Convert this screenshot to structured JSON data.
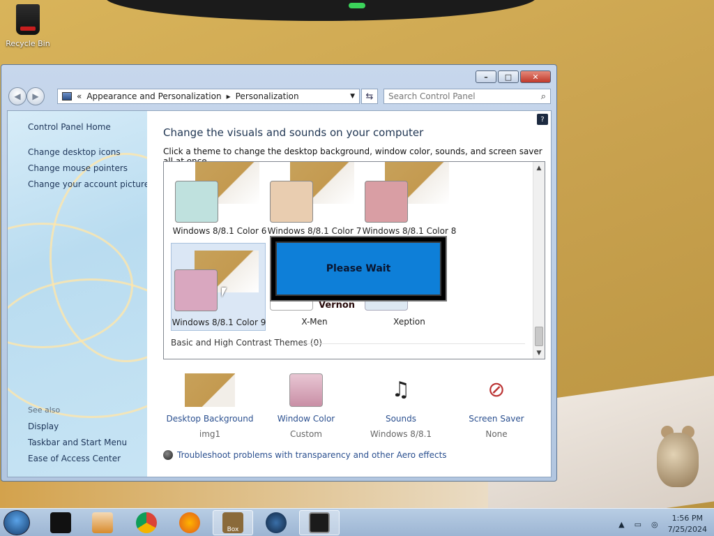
{
  "desktop": {
    "recycle_bin": "Recycle Bin"
  },
  "window": {
    "address_parts": [
      "«",
      "Appearance and Personalization",
      "▸",
      "Personalization"
    ],
    "search_placeholder": "Search Control Panel"
  },
  "sidebar": {
    "home": "Control Panel Home",
    "items": [
      "Change desktop icons",
      "Change mouse pointers",
      "Change your account picture"
    ],
    "see_also": "See also",
    "see_also_items": [
      "Display",
      "Taskbar and Start Menu",
      "Ease of Access Center"
    ]
  },
  "main": {
    "title": "Change the visuals and sounds on your computer",
    "subtitle": "Click a theme to change the desktop background, window color, sounds, and screen saver all at once.",
    "themes": [
      {
        "name": "Windows 8/8.1 Color 6",
        "color": "#bfe1de"
      },
      {
        "name": "Windows 8/8.1 Color 7",
        "color": "#e9cdb0"
      },
      {
        "name": "Windows 8/8.1 Color 8",
        "color": "#d99ea4"
      },
      {
        "name": "Windows 8/8.1 Color 9",
        "color": "#d9a7bf"
      },
      {
        "name": "X-Men",
        "color": "#ffffff"
      },
      {
        "name": "Xeption",
        "color": "#dde8f2"
      }
    ],
    "basic_themes": "Basic and High Contrast Themes (0)",
    "please_wait": "Please Wait",
    "watermark": "Vernon",
    "options": [
      {
        "name": "Desktop Background",
        "value": "img1"
      },
      {
        "name": "Window Color",
        "value": "Custom"
      },
      {
        "name": "Sounds",
        "value": "Windows 8/8.1"
      },
      {
        "name": "Screen Saver",
        "value": "None"
      }
    ],
    "troubleshoot": "Troubleshoot problems with transparency and other Aero effects"
  },
  "taskbar": {
    "time": "1:56 PM",
    "date": "7/25/2024",
    "box_label": "Box"
  }
}
